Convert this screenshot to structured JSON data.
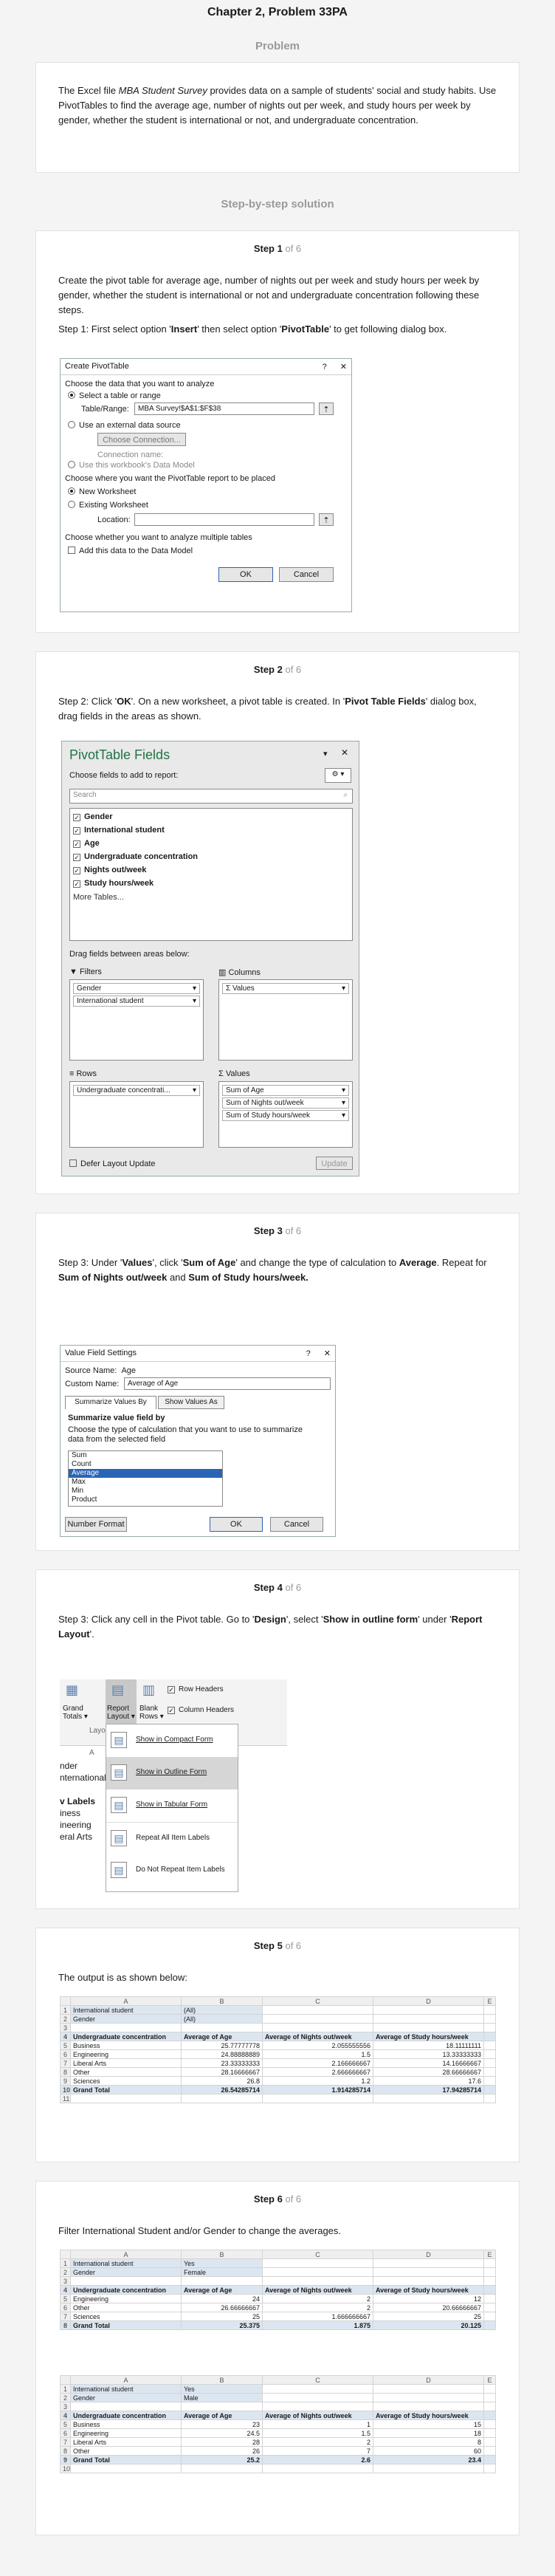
{
  "page_title": "Chapter 2, Problem 33PA",
  "problem": {
    "heading": "Problem",
    "text_pre": "The Excel file ",
    "text_em": "MBA Student Survey",
    "text_post": " provides data on a sample of students' social and study habits. Use PivotTables to find the average age, number of nights out per week, and study hours per week by gender, whether the student is international or not, and undergraduate concentration."
  },
  "solution_heading": "Step-by-step solution",
  "steps": [
    {
      "label": "Step 1",
      "of": "of 6"
    },
    {
      "label": "Step 2",
      "of": "of 6"
    },
    {
      "label": "Step 3",
      "of": "of 6"
    },
    {
      "label": "Step 4",
      "of": "of 6"
    },
    {
      "label": "Step 5",
      "of": "of 6"
    },
    {
      "label": "Step 6",
      "of": "of 6"
    }
  ],
  "step1": {
    "intro": "Create the pivot table for average age, number of nights out per week and study hours per week by gender, whether the student is international or not and undergraduate concentration following these steps.",
    "inst_a": "Step 1: First select option '",
    "inst_b": "Insert",
    "inst_c": "' then select option '",
    "inst_d": "PivotTable",
    "inst_e": "' to get following dialog box.",
    "dialog": {
      "title": "Create PivotTable",
      "help": "?",
      "close": "✕",
      "choose_data": "Choose the data that you want to analyze",
      "opt_select": "Select a table or range",
      "table_range_label": "Table/Range:",
      "table_range_value": "MBA Survey!$A$1:$F$38",
      "opt_external": "Use an external data source",
      "choose_conn": "Choose Connection...",
      "conn_name": "Connection name:",
      "use_model": "Use this workbook's Data Model",
      "where_place": "Choose where you want the PivotTable report to be placed",
      "opt_new": "New Worksheet",
      "opt_existing": "Existing Worksheet",
      "location": "Location:",
      "multi": "Choose whether you want to analyze multiple tables",
      "add_model": "Add this data to the Data Model",
      "ok": "OK",
      "cancel": "Cancel"
    }
  },
  "step2": {
    "inst_a": "Step 2: Click '",
    "inst_b": "OK",
    "inst_c": "'. On a new worksheet, a pivot table is created. In '",
    "inst_d": "Pivot Table Fields",
    "inst_e": "' dialog box, drag fields in the areas as shown.",
    "pane": {
      "title": "PivotTable Fields",
      "subtitle": "Choose fields to add to report:",
      "search": "Search",
      "fields": [
        "Gender",
        "International student",
        "Age",
        "Undergraduate concentration",
        "Nights out/week",
        "Study hours/week"
      ],
      "more_tables": "More Tables...",
      "drag_hint": "Drag fields between areas below:",
      "filters_label": "Filters",
      "columns_label": "Columns",
      "rows_label": "Rows",
      "values_label": "Values",
      "filters": [
        "Gender",
        "International student"
      ],
      "columns": [
        "Σ Values"
      ],
      "rows": [
        "Undergraduate concentrati..."
      ],
      "values": [
        "Sum of Age",
        "Sum of Nights out/week",
        "Sum of Study hours/week"
      ],
      "defer": "Defer Layout Update",
      "update": "Update"
    }
  },
  "step3": {
    "inst_a": "Step 3: Under '",
    "inst_b": "Values",
    "inst_c": "', click '",
    "inst_d": "Sum of Age",
    "inst_e": "' and change the type of calculation to ",
    "inst_f": "Average",
    "inst_g": ". Repeat for ",
    "inst_h": "Sum of Nights out/week",
    "inst_i": " and ",
    "inst_j": "Sum of Study hours/week.",
    "dialog": {
      "title": "Value Field Settings",
      "help": "?",
      "close": "✕",
      "source_label": "Source Name:",
      "source_value": "Age",
      "custom_label": "Custom Name:",
      "custom_value": "Average of Age",
      "tab1": "Summarize Values By",
      "tab2": "Show Values As",
      "sum_by": "Summarize value field by",
      "choose_type": "Choose the type of calculation that you want to use to summarize data from the selected field",
      "list": [
        "Sum",
        "Count",
        "Average",
        "Max",
        "Min",
        "Product"
      ],
      "selected": "Average",
      "numfmt": "Number Format",
      "ok": "OK",
      "cancel": "Cancel"
    }
  },
  "step4": {
    "inst_a": "Step 3: Click any cell in the Pivot table. Go to '",
    "inst_b": "Design",
    "inst_c": "', select '",
    "inst_d": "Show in outline form",
    "inst_e": "' under '",
    "inst_f": "Report Layout",
    "inst_g": "'.",
    "ribbon": {
      "grand": "Grand",
      "totals": "Totals",
      "report": "Report",
      "layout": "Layout",
      "blank": "Blank",
      "rows": "Rows",
      "row_headers": "Row Headers",
      "column_headers": "Column Headers",
      "layo": "Layo",
      "col_a": "A"
    },
    "menu": [
      "Show in Compact Form",
      "Show in Outline Form",
      "Show in Tabular Form",
      "Repeat All Item Labels",
      "Do Not Repeat Item Labels"
    ],
    "bg_rows": [
      "nder",
      "nternational",
      "",
      "v Labels",
      "iness",
      "ineering",
      "eral Arts"
    ]
  },
  "step5": {
    "text": "The output is as shown below:",
    "cols": [
      "A",
      "B",
      "C",
      "D",
      "E"
    ],
    "rows": [
      [
        "1",
        "International student",
        "(All)",
        "",
        "",
        ""
      ],
      [
        "2",
        "Gender",
        "(All)",
        "",
        "",
        ""
      ],
      [
        "3",
        "",
        "",
        "",
        "",
        ""
      ],
      [
        "4",
        "Undergraduate concentration",
        "Average of Age",
        "Average of Nights out/week",
        "Average of Study hours/week",
        ""
      ],
      [
        "5",
        "Business",
        "25.77777778",
        "2.055555556",
        "18.11111111",
        ""
      ],
      [
        "6",
        "Engineering",
        "24.88888889",
        "1.5",
        "13.33333333",
        ""
      ],
      [
        "7",
        "Liberal Arts",
        "23.33333333",
        "2.166666667",
        "14.16666667",
        ""
      ],
      [
        "8",
        "Other",
        "28.16666667",
        "2.666666667",
        "28.66666667",
        ""
      ],
      [
        "9",
        "Sciences",
        "26.8",
        "1.2",
        "17.6",
        ""
      ],
      [
        "10",
        "Grand Total",
        "26.54285714",
        "1.914285714",
        "17.94285714",
        ""
      ],
      [
        "11",
        "",
        "",
        "",
        "",
        ""
      ]
    ]
  },
  "step6": {
    "text": "Filter International Student and/or Gender to change the averages.",
    "cols": [
      "A",
      "B",
      "C",
      "D",
      "E"
    ],
    "table1": [
      [
        "1",
        "International student",
        "Yes",
        "",
        "",
        ""
      ],
      [
        "2",
        "Gender",
        "Female",
        "",
        "",
        ""
      ],
      [
        "3",
        "",
        "",
        "",
        "",
        ""
      ],
      [
        "4",
        "Undergraduate concentration",
        "Average of Age",
        "Average of Nights out/week",
        "Average of Study hours/week",
        ""
      ],
      [
        "5",
        "Engineering",
        "24",
        "2",
        "12",
        ""
      ],
      [
        "6",
        "Other",
        "26.66666667",
        "2",
        "20.66666667",
        ""
      ],
      [
        "7",
        "Sciences",
        "25",
        "1.666666667",
        "25",
        ""
      ],
      [
        "8",
        "Grand Total",
        "25.375",
        "1.875",
        "20.125",
        ""
      ]
    ],
    "table2": [
      [
        "1",
        "International student",
        "Yes",
        "",
        "",
        ""
      ],
      [
        "2",
        "Gender",
        "Male",
        "",
        "",
        ""
      ],
      [
        "3",
        "",
        "",
        "",
        "",
        ""
      ],
      [
        "4",
        "Undergraduate concentration",
        "Average of Age",
        "Average of Nights out/week",
        "Average of Study hours/week",
        ""
      ],
      [
        "5",
        "Business",
        "23",
        "1",
        "15",
        ""
      ],
      [
        "6",
        "Engineering",
        "24.5",
        "1.5",
        "18",
        ""
      ],
      [
        "7",
        "Liberal Arts",
        "28",
        "2",
        "8",
        ""
      ],
      [
        "8",
        "Other",
        "26",
        "7",
        "60",
        ""
      ],
      [
        "9",
        "Grand Total",
        "25.2",
        "2.6",
        "23.4",
        ""
      ],
      [
        "10",
        "",
        "",
        "",
        "",
        ""
      ]
    ]
  }
}
